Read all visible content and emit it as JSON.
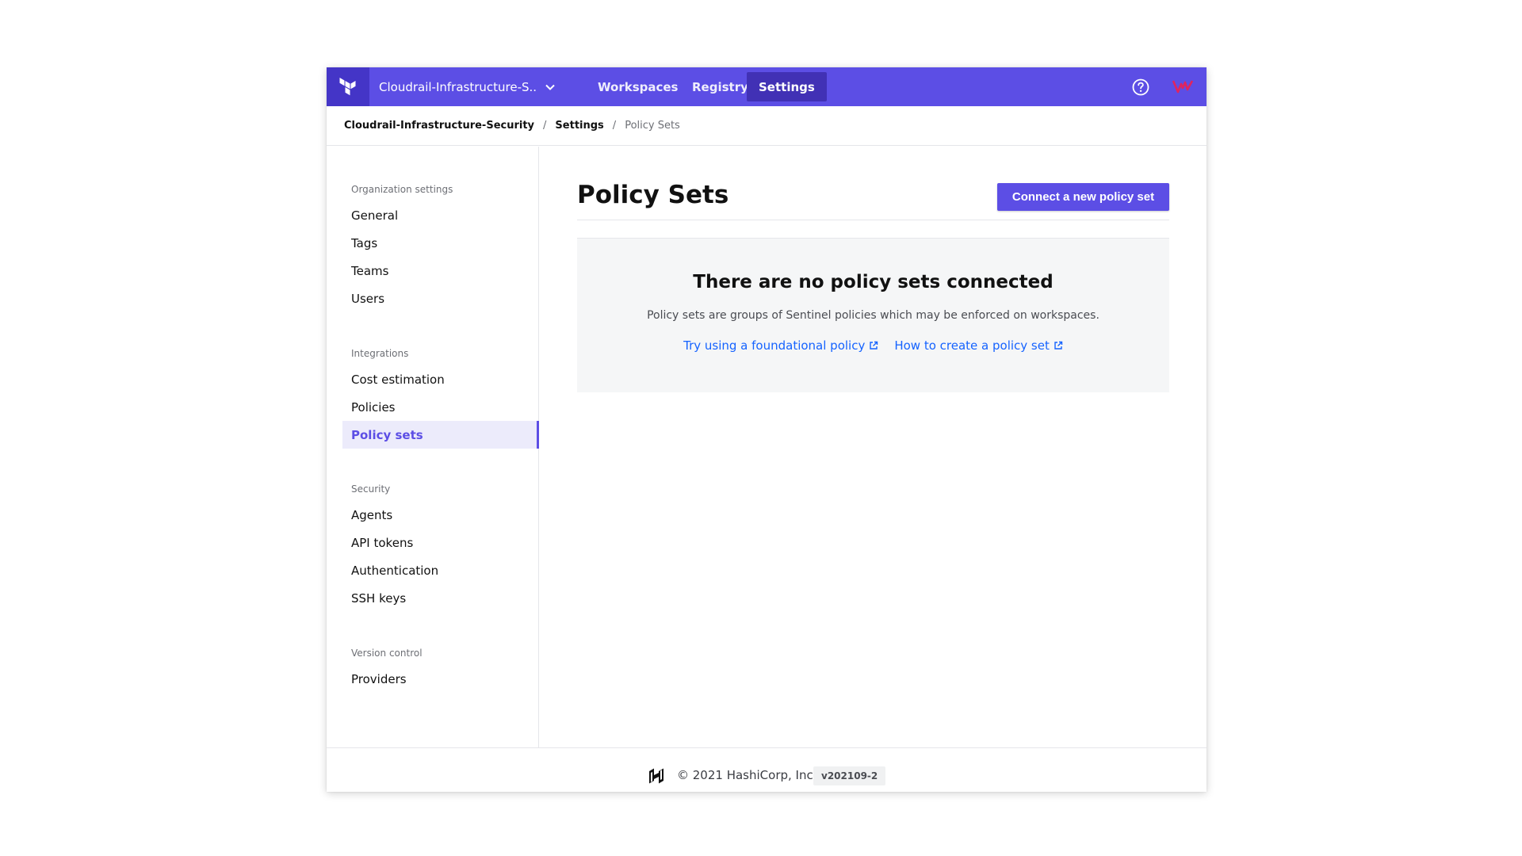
{
  "topnav": {
    "org_name": "Cloudrail-Infrastructure-S...",
    "links": [
      "Workspaces",
      "Registry",
      "Settings"
    ],
    "active_link": "Settings",
    "icons": [
      "terraform-logo-icon",
      "chevron-down-icon",
      "help-icon",
      "user-avatar-icon"
    ]
  },
  "breadcrumb": {
    "items": [
      "Cloudrail-Infrastructure-Security",
      "Settings",
      "Policy Sets"
    ],
    "separator": "/"
  },
  "sidebar": {
    "sections": [
      {
        "title": "Organization settings",
        "items": [
          "General",
          "Tags",
          "Teams",
          "Users"
        ]
      },
      {
        "title": "Integrations",
        "items": [
          "Cost estimation",
          "Policies",
          "Policy sets"
        ]
      },
      {
        "title": "Security",
        "items": [
          "Agents",
          "API tokens",
          "Authentication",
          "SSH keys"
        ]
      },
      {
        "title": "Version control",
        "items": [
          "Providers"
        ]
      }
    ],
    "active_item": "Policy sets"
  },
  "main": {
    "title": "Policy Sets",
    "primary_button": "Connect a new policy set",
    "empty_state": {
      "title": "There are no policy sets connected",
      "description": "Policy sets are groups of Sentinel policies which may be enforced on workspaces.",
      "links": [
        "Try using a foundational policy",
        "How to create a policy set"
      ]
    }
  },
  "footer": {
    "copyright": "© 2021 HashiCorp, Inc.",
    "version": "v202109-2"
  },
  "colors": {
    "brand": "#5c4ee5",
    "brand_dark": "#4435c7",
    "link": "#1563ff",
    "avatar": "#e0245e"
  }
}
